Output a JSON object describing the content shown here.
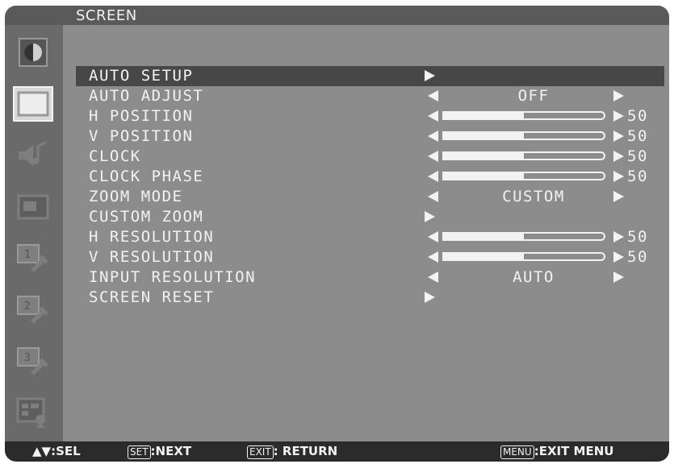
{
  "title": "SCREEN",
  "sidebar": {
    "icons": [
      "picture-icon",
      "screen-icon",
      "audio-icon",
      "pip-icon",
      "option1-icon",
      "option2-icon",
      "option3-icon",
      "multi-input-icon"
    ],
    "active_index": 1
  },
  "menu": {
    "items": [
      {
        "label": "AUTO SETUP",
        "control": "enter"
      },
      {
        "label": "AUTO ADJUST",
        "control": "option",
        "value": "OFF"
      },
      {
        "label": "H POSITION",
        "control": "slider",
        "value": "50",
        "level": 0.5
      },
      {
        "label": "V POSITION",
        "control": "slider",
        "value": "50",
        "level": 0.5
      },
      {
        "label": "CLOCK",
        "control": "slider",
        "value": "50",
        "level": 0.5
      },
      {
        "label": "CLOCK PHASE",
        "control": "slider",
        "value": "50",
        "level": 0.5
      },
      {
        "label": "ZOOM MODE",
        "control": "option",
        "value": "CUSTOM"
      },
      {
        "label": "CUSTOM ZOOM",
        "control": "enter"
      },
      {
        "label": "H RESOLUTION",
        "control": "slider",
        "value": "50",
        "level": 0.5
      },
      {
        "label": "V RESOLUTION",
        "control": "slider",
        "value": "50",
        "level": 0.5
      },
      {
        "label": "INPUT RESOLUTION",
        "control": "option",
        "value": "AUTO"
      },
      {
        "label": "SCREEN RESET",
        "control": "enter"
      }
    ],
    "selected_index": 0
  },
  "help": {
    "sel_label": ":SEL",
    "set_key": "SET",
    "next_label": ":NEXT",
    "exit_key": "EXIT",
    "return_label": ": RETURN",
    "menu_key": "MENU",
    "exit_menu_label": ":EXIT MENU"
  },
  "colors": {
    "osd_background": "#8c8c8c",
    "title_bar": "#5a5a5a",
    "sidebar": "#6a6a6a",
    "highlight_row": "#474747",
    "help_bar": "#2b2b2b",
    "text": "#f2f2f2"
  }
}
